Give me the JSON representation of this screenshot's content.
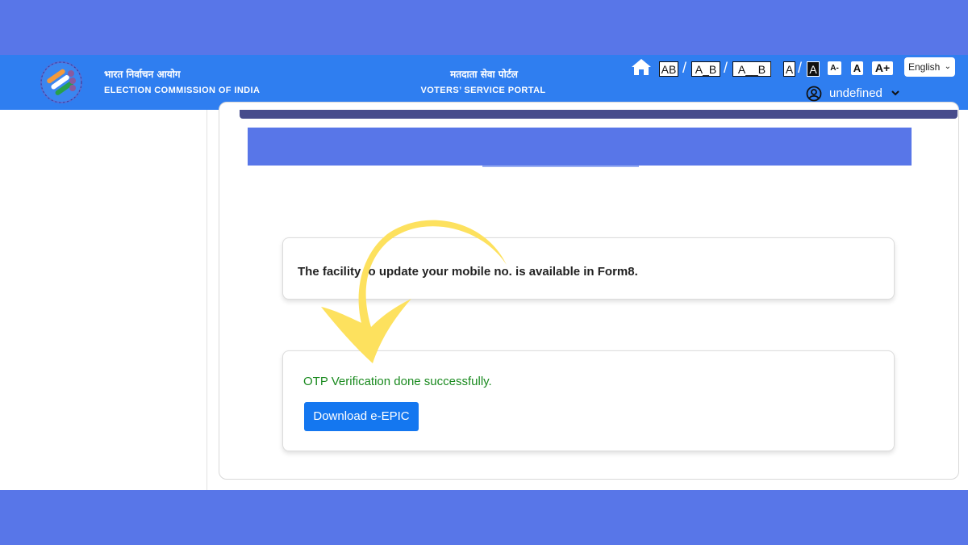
{
  "header": {
    "org_hindi": "भारत निर्वाचन आयोग",
    "org_english": "ELECTION COMMISSION OF INDIA",
    "portal_hindi": "मतदाता सेवा पोर्टल",
    "portal_english": "VOTERS’ SERVICE PORTAL",
    "toolbar": {
      "spacing_1": "AB",
      "spacing_2": "A_B",
      "spacing_3": "A__B",
      "separator": "/",
      "contrast_light": "A",
      "contrast_dark": "A",
      "font_decrease": "A-",
      "font_normal": "A",
      "font_increase": "A+"
    },
    "language": "English",
    "user_name": "undefined"
  },
  "main": {
    "info_message": "The facility to update your mobile no. is available in Form8.",
    "otp_message": "OTP Verification done successfully.",
    "download_button": "Download e-EPIC"
  },
  "colors": {
    "page_background": "#5876e8",
    "header": "#2f7ef0",
    "success_text": "#1a8a1f",
    "button": "#1477f0",
    "arrow": "#fde15e"
  },
  "icons": [
    "home-icon",
    "user-circle-icon",
    "chevron-down-icon",
    "eci-logo"
  ]
}
